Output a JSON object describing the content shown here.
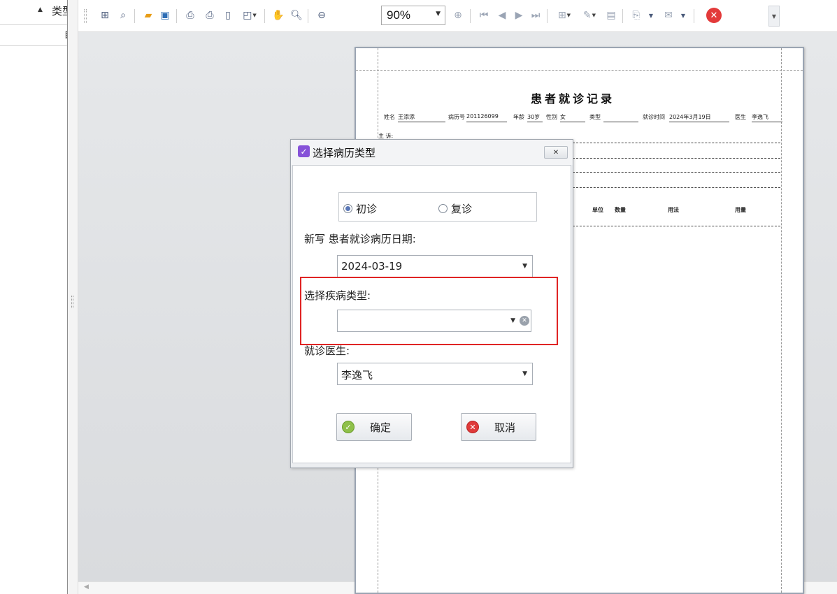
{
  "left_panel": {
    "column_header": "类型",
    "sub_header": "目"
  },
  "toolbar": {
    "zoom_value": "90%"
  },
  "document": {
    "title": "患者就诊记录",
    "name_label": "姓名",
    "name_value": "王添添",
    "record_no_label": "病历号",
    "record_no_value": "201126099",
    "age_label": "年龄",
    "age_value": "30岁",
    "gender_label": "性别",
    "gender_value": "女",
    "type_label": "类型",
    "visit_time_label": "就诊时间",
    "visit_time_value": "2024年3月19日",
    "doctor_label": "医生",
    "doctor_value": "李逸飞",
    "complaint_label": "主 诉:",
    "columns": [
      "单位",
      "数量",
      "用法",
      "用量"
    ]
  },
  "dialog": {
    "title": "选择病历类型",
    "radio_first": "初诊",
    "radio_return": "复诊",
    "date_label": "新写 患者就诊病历日期:",
    "date_value": "2024-03-19",
    "disease_label": "选择疾病类型:",
    "disease_value": "",
    "doctor_label": "就诊医生:",
    "doctor_value": "李逸飞",
    "ok_label": "确定",
    "cancel_label": "取消"
  },
  "colors": {
    "highlight": "#e02424",
    "accent_purple": "#8652d8"
  }
}
